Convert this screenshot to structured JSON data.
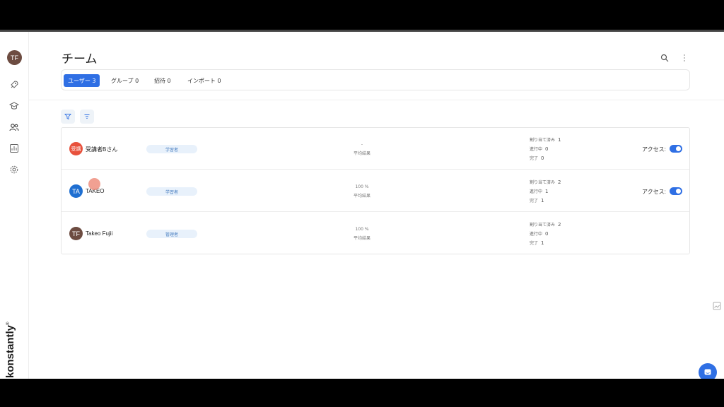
{
  "user": {
    "initials": "TF"
  },
  "brand": {
    "name": "konstantly",
    "mark": "®"
  },
  "page": {
    "title": "チーム"
  },
  "tabs": [
    {
      "label": "ユーザー 3",
      "active": true
    },
    {
      "label": "グループ 0",
      "active": false
    },
    {
      "label": "招待 0",
      "active": false
    },
    {
      "label": "インポート 0",
      "active": false
    }
  ],
  "rows": [
    {
      "initials": "受講",
      "avatar_color": "#e8513c",
      "name": "受講者Bさん",
      "role": "学習者",
      "result_value": "-",
      "result_label": "平均結果",
      "assigned_label": "割り当て済み",
      "assigned": "1",
      "in_progress_label": "進行中",
      "in_progress": "0",
      "completed_label": "完了",
      "completed": "0",
      "access_label": "アクセス:",
      "access_on": true
    },
    {
      "initials": "TA",
      "avatar_color": "#1f6fd1",
      "name": "TAKEO",
      "role": "学習者",
      "result_value": "100 %",
      "result_label": "平均結果",
      "assigned_label": "割り当て済み",
      "assigned": "2",
      "in_progress_label": "進行中",
      "in_progress": "1",
      "completed_label": "完了",
      "completed": "1",
      "access_label": "アクセス:",
      "access_on": true
    },
    {
      "initials": "TF",
      "avatar_color": "#6d4c41",
      "name": "Takeo Fujii",
      "role": "管理者",
      "result_value": "100 %",
      "result_label": "平均結果",
      "assigned_label": "割り当て済み",
      "assigned": "2",
      "in_progress_label": "進行中",
      "in_progress": "0",
      "completed_label": "完了",
      "completed": "1"
    }
  ],
  "colors": {
    "accent": "#2f6fe4"
  }
}
